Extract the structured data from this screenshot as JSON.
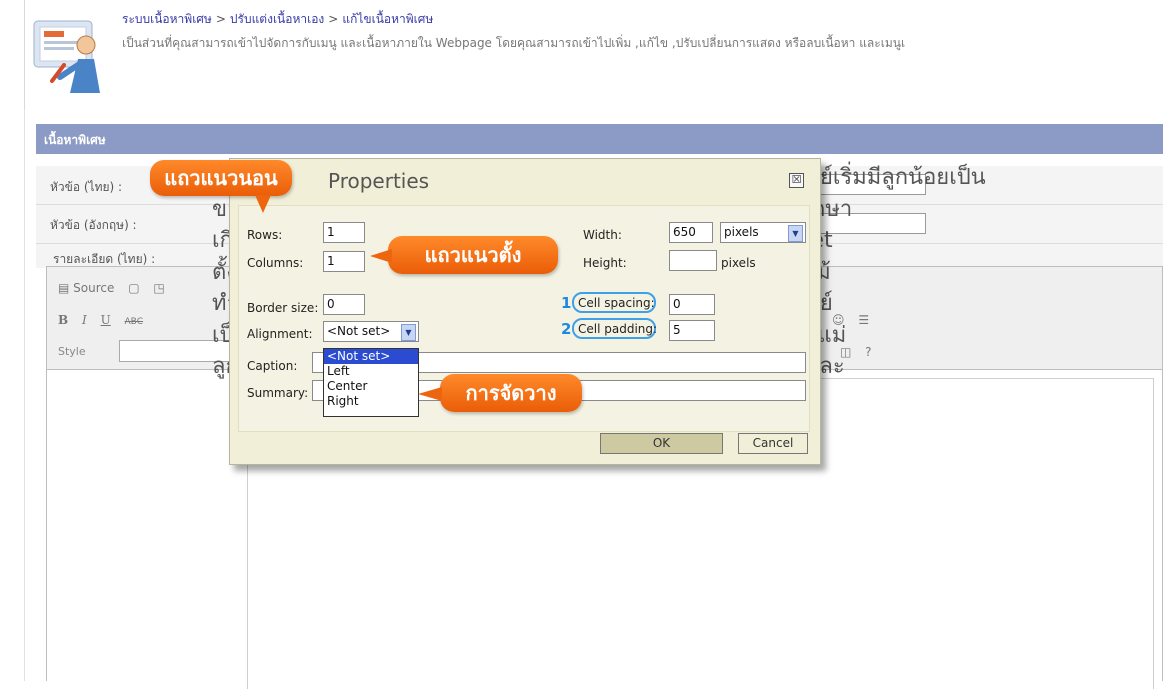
{
  "header": {
    "breadcrumb": [
      "ระบบเนื้อหาพิเศษ",
      "ปรับแต่งเนื้อหาเอง",
      "แก้ไขเนื้อหาพิเศษ"
    ],
    "breadcrumb_sep": ">",
    "description": "เป็นส่วนที่คุณสามารถเข้าไปจัดการกับเมนู และเนื้อหาภายใน Webpage โดยคุณสามารถเข้าไปเพิ่ม ,แก้ไข ,ปรับเปลี่ยนการแสดง หรือลบเนื้อหา และเมนูเ"
  },
  "panel": {
    "title": "เนื้อหาพิเศษ",
    "fields": {
      "title_th": "หัวข้อ (ไทย) :",
      "title_en": "หัวข้อ (อังกฤษ) :",
      "detail_th": "รายละเอียด (ไทย) :"
    }
  },
  "editor": {
    "source_label": "Source",
    "style_label": "Style",
    "content_lines": [
      "การที่เมย์เริ่มมีลูกน้อยเป็น",
      "ของตัวเอง ^^ ด้วยขนาดตัวที่ค่อยๆขยายใหญ่ขึ้นทำให้เมย์เริ่มศึกษา",
      "เกี่ยวกับเสื้อผ้าสำหรับคุณแม่ เคยลองหาหรือสั่งซื้อมาจาก Internet",
      "ตั้งหลายครั้งแต่ก็ไม่เคยได้แบบที่ถูกใจ นำมาซึ่งความสงสัยว่าทำไม้",
      "ทำไมถึงไม่ค่อยมีเสื้อผ้าคุณแม่ที่ดูดีบ้างเลยนะ ประกอบกับการที่เมย์",
      "เป็นคนชอบแต่งตัวอยู่แล้วจึงเกิดแรงบันดาลในที่จะทำชุดคู่เหมือนแม่",
      "ลูก พ่อลูก และเสื้อครอบครัว ที่ดูดี ทันสมัย ใช้วัสดุเนื้อผ้าอย่างดี และ"
    ]
  },
  "dialog": {
    "title": "Properties",
    "close_glyph": "☒",
    "rows_label": "Rows:",
    "rows_value": "1",
    "columns_label": "Columns:",
    "columns_value": "1",
    "width_label": "Width:",
    "width_value": "650",
    "width_unit": "pixels",
    "height_label": "Height:",
    "height_value": "",
    "height_unit": "pixels",
    "border_label": "Border size:",
    "border_value": "0",
    "alignment_label": "Alignment:",
    "alignment_value": "<Not set>",
    "alignment_options": [
      "<Not set>",
      "Left",
      "Center",
      "Right"
    ],
    "cell_spacing_label": "Cell spacing:",
    "cell_spacing_value": "0",
    "cell_padding_label": "Cell padding:",
    "cell_padding_value": "5",
    "caption_label": "Caption:",
    "summary_label": "Summary:",
    "ok_label": "OK",
    "cancel_label": "Cancel"
  },
  "annotations": {
    "rows_callout": "แถวแนวนอน",
    "columns_callout": "แถวแนวตั้ง",
    "alignment_callout": "การจัดวาง",
    "spacing_number": "1",
    "padding_number": "2"
  },
  "colors": {
    "panel_header": "#8b9bc5",
    "dialog_bg": "#f1efd7",
    "callout_orange": "#f07014",
    "ring_blue": "#3da0e8",
    "selected_option": "#2b4bd1"
  }
}
